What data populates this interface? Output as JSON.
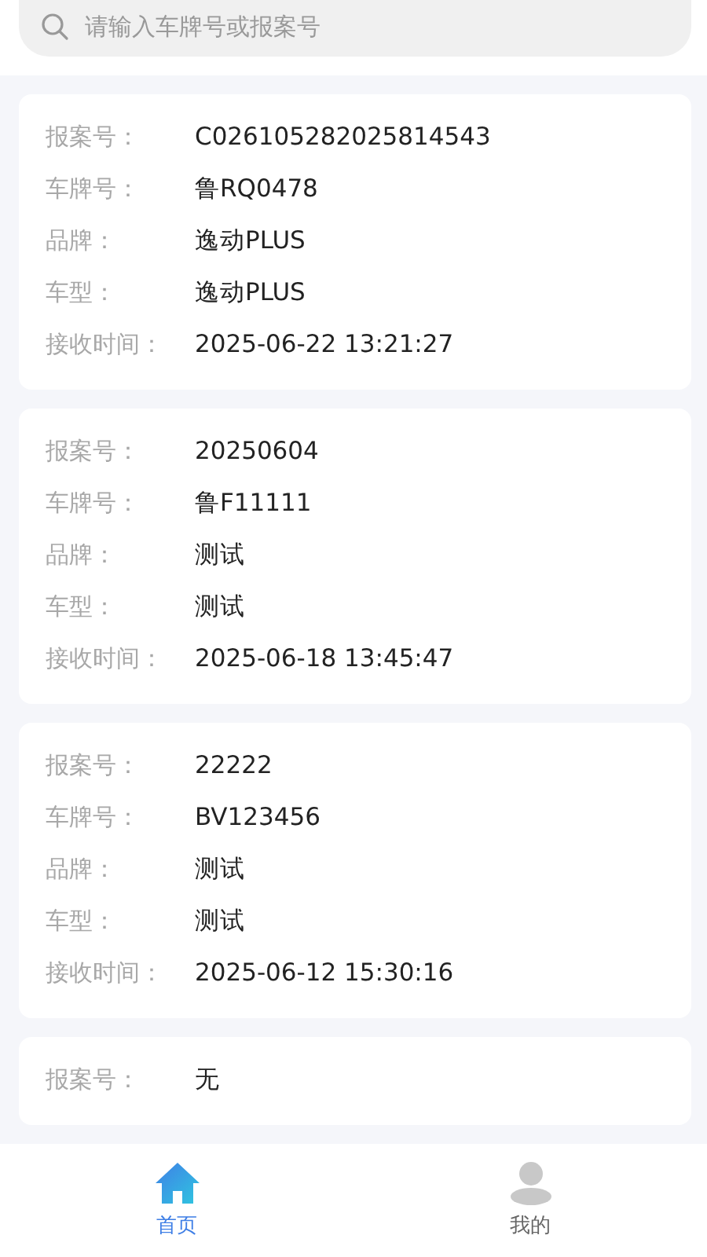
{
  "search": {
    "placeholder": "请输入车牌号或报案号"
  },
  "records": [
    {
      "fields": [
        {
          "label": "报案号：",
          "value": "C026105282025814543"
        },
        {
          "label": "车牌号：",
          "value": "鲁RQ0478"
        },
        {
          "label": "品牌：",
          "value": "逸动PLUS"
        },
        {
          "label": "车型：",
          "value": "逸动PLUS"
        },
        {
          "label": "接收时间：",
          "value": "2025-06-22 13:21:27"
        }
      ]
    },
    {
      "fields": [
        {
          "label": "报案号：",
          "value": "20250604"
        },
        {
          "label": "车牌号：",
          "value": "鲁F11111"
        },
        {
          "label": "品牌：",
          "value": "测试"
        },
        {
          "label": "车型：",
          "value": "测试"
        },
        {
          "label": "接收时间：",
          "value": "2025-06-18 13:45:47"
        }
      ]
    },
    {
      "fields": [
        {
          "label": "报案号：",
          "value": "22222"
        },
        {
          "label": "车牌号：",
          "value": "BV123456"
        },
        {
          "label": "品牌：",
          "value": "测试"
        },
        {
          "label": "车型：",
          "value": "测试"
        },
        {
          "label": "接收时间：",
          "value": "2025-06-12 15:30:16"
        }
      ]
    },
    {
      "fields": [
        {
          "label": "报案号：",
          "value": "无"
        }
      ]
    }
  ],
  "tabs": [
    {
      "label": "首页",
      "kind": "home",
      "selected": true
    },
    {
      "label": "我的",
      "kind": "profile",
      "selected": false
    }
  ]
}
